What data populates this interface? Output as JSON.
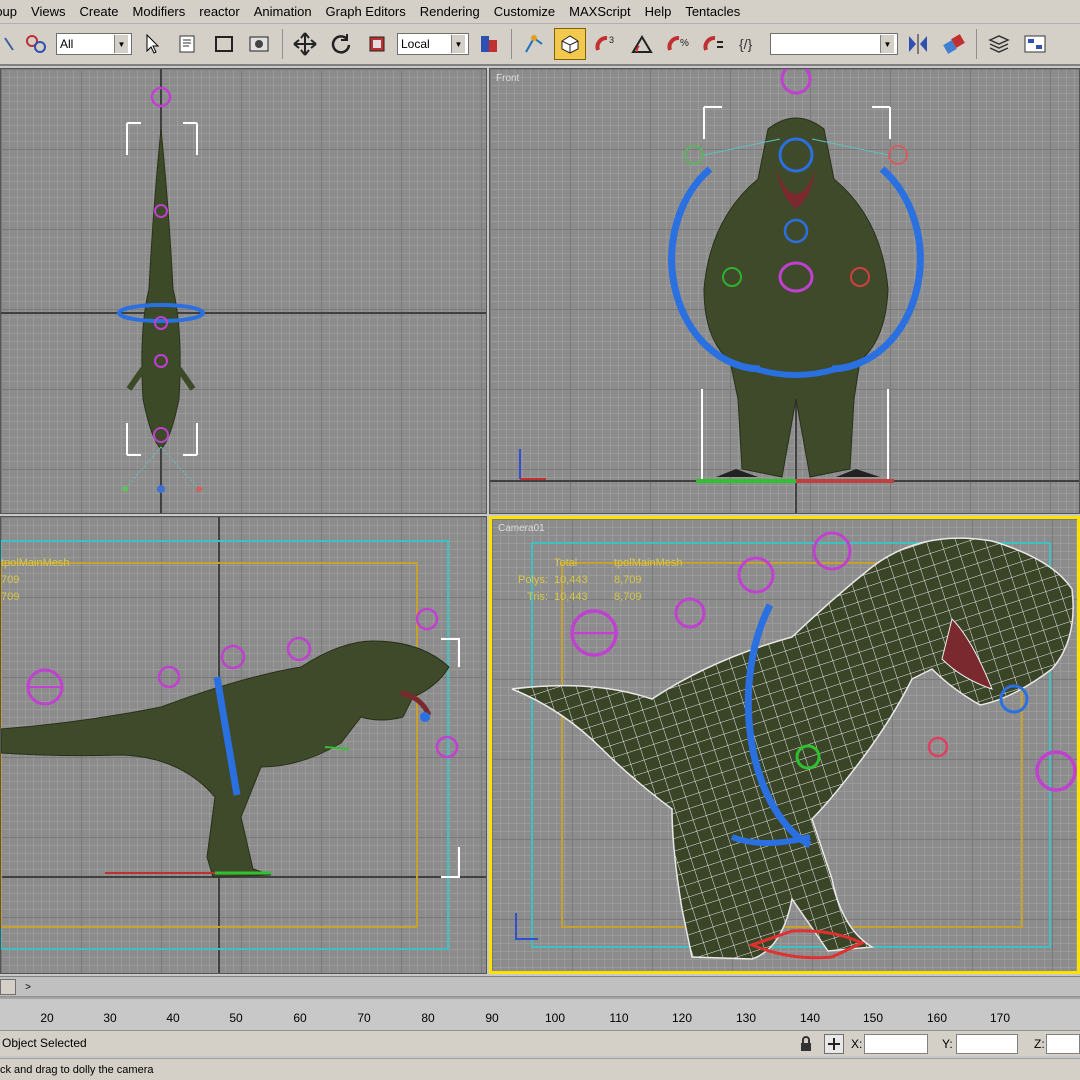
{
  "menu": [
    "roup",
    "Views",
    "Create",
    "Modifiers",
    "reactor",
    "Animation",
    "Graph Editors",
    "Rendering",
    "Customize",
    "MAXScript",
    "Help",
    "Tentacles"
  ],
  "toolbar": {
    "selection_filter": "All",
    "coordinate_system": "Local",
    "named_selection": ""
  },
  "viewports": {
    "top": {
      "label": ""
    },
    "front": {
      "label": "Front"
    },
    "left": {
      "label": "",
      "stats": {
        "header": "tpolMainMesh",
        "row1": "709",
        "row2": "709"
      }
    },
    "camera": {
      "label": "Camera01",
      "stats": {
        "col_total": "Total",
        "col_mesh": "tpolMainMesh",
        "polys_label": "Polys:",
        "polys_total": "10,443",
        "polys_mesh": "8,709",
        "tris_label": "Tris:",
        "tris_total": "10,443",
        "tris_mesh": "8,709"
      }
    }
  },
  "timeline": {
    "ticks": [
      "20",
      "30",
      "40",
      "50",
      "60",
      "70",
      "80",
      "90",
      "100",
      "110",
      "120",
      "130",
      "140",
      "150",
      "160",
      "170"
    ],
    "slider_arrow": ">"
  },
  "status": {
    "selection": "Object Selected",
    "prompt": "ck and drag to dolly the camera",
    "x_label": "X:",
    "y_label": "Y:",
    "z_label": "Z:",
    "x_value": "",
    "y_value": "",
    "z_value": ""
  },
  "colors": {
    "viewport_bg": "#8c8c8c",
    "active_border": "#ffe100",
    "stats_text": "#d8c84a",
    "safe_frame": "#40c0c0",
    "title_safe": "#c8a030",
    "helper_magenta": "#c040d0",
    "helper_blue": "#2060d0"
  }
}
